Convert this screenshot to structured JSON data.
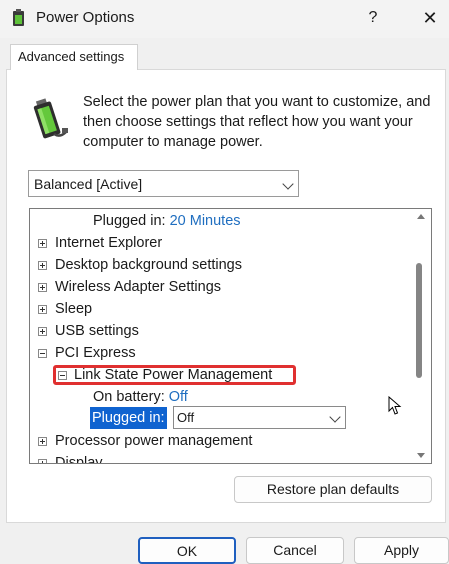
{
  "window": {
    "title": "Power Options",
    "help_label": "?",
    "close_label": "✕",
    "app_icon": "power-options-icon"
  },
  "tab": {
    "label": "Advanced settings"
  },
  "description": "Select the power plan that you want to customize, and then choose settings that reflect how you want your computer to manage power.",
  "plan_select": {
    "value": "Balanced [Active]"
  },
  "tree": {
    "partial_top": {
      "label": "Plugged in:",
      "value": "20 Minutes"
    },
    "items": [
      {
        "label": "Internet Explorer"
      },
      {
        "label": "Desktop background settings"
      },
      {
        "label": "Wireless Adapter Settings"
      },
      {
        "label": "Sleep"
      },
      {
        "label": "USB settings"
      },
      {
        "label": "PCI Express"
      },
      {
        "label": "Link State Power Management"
      },
      {
        "label": "Processor power management"
      },
      {
        "label": "Display"
      }
    ],
    "on_battery": {
      "label": "On battery:",
      "value": "Off"
    },
    "plugged_in": {
      "label": "Plugged in:",
      "value": "Off"
    }
  },
  "buttons": {
    "restore": "Restore plan defaults",
    "ok": "OK",
    "cancel": "Cancel",
    "apply": "Apply"
  },
  "colors": {
    "selection": "#0f63d0",
    "value_link": "#1f6ec0",
    "highlight_outline": "#e03030",
    "ok_border": "#1f5fbf"
  }
}
